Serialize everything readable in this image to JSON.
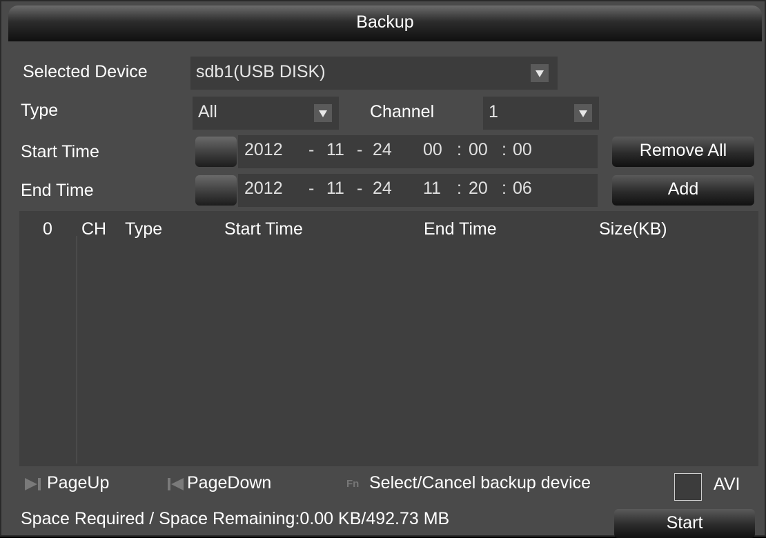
{
  "window": {
    "title": "Backup"
  },
  "form": {
    "selected_device": {
      "label": "Selected Device",
      "value": "sdb1(USB DISK)"
    },
    "type": {
      "label": "Type",
      "value": "All"
    },
    "channel": {
      "label": "Channel",
      "value": "1"
    },
    "start_time": {
      "label": "Start Time",
      "year": "2012",
      "month": "11",
      "day": "24",
      "hour": "00",
      "minute": "00",
      "second": "00"
    },
    "end_time": {
      "label": "End Time",
      "year": "2012",
      "month": "11",
      "day": "24",
      "hour": "11",
      "minute": "20",
      "second": "06"
    },
    "date_sep": "-",
    "time_sep": ":"
  },
  "buttons": {
    "remove_all": "Remove All",
    "add": "Add",
    "start": "Start"
  },
  "table": {
    "headers": [
      "0",
      "CH",
      "Type",
      "Start Time",
      "End Time",
      "Size(KB)"
    ],
    "rows": []
  },
  "footer": {
    "page_up": "PageUp",
    "page_down": "PageDown",
    "fn_label": "Fn",
    "select_cancel": "Select/Cancel backup device",
    "avi_label": "AVI",
    "avi_checked": false,
    "space_label": "Space Required / Space Remaining:",
    "space_value": "0.00 KB/492.73 MB"
  },
  "icons": {
    "dropdown": "chevron-down-icon",
    "calendar": "calendar-button",
    "page_up": "page-up-icon",
    "page_down": "page-down-icon",
    "fn_key": "fn-key-icon"
  }
}
